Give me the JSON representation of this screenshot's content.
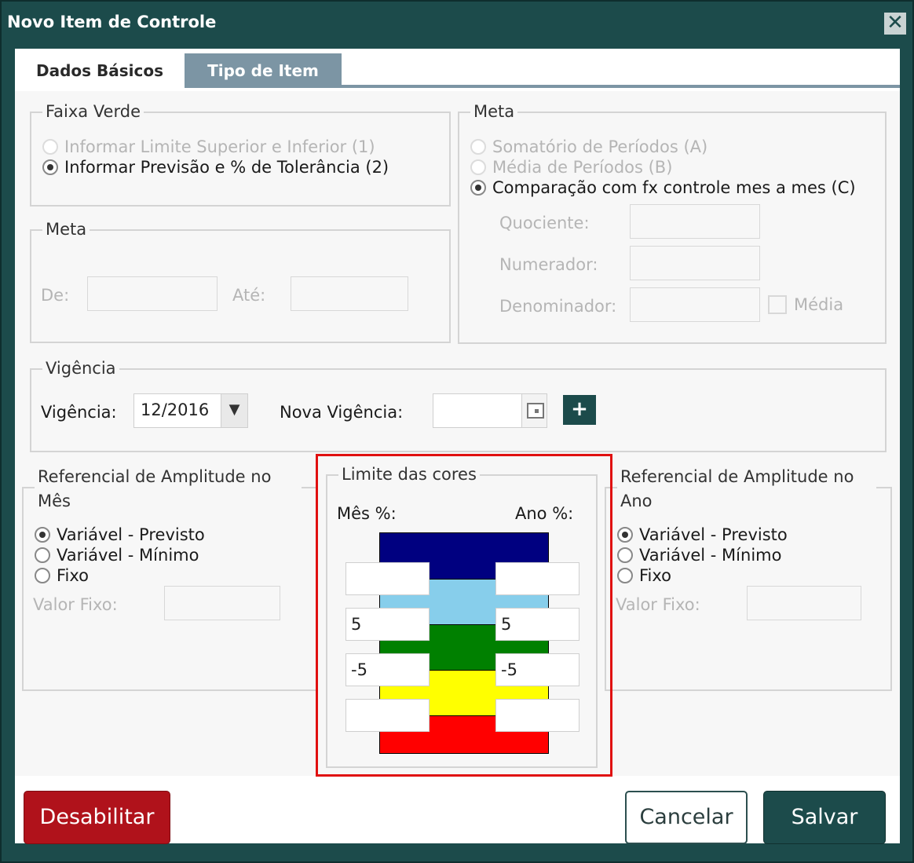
{
  "dialog": {
    "title": "Novo Item de Controle",
    "close_symbol": "✕"
  },
  "tabs": [
    "Dados Básicos",
    "Tipo de Item"
  ],
  "faixa_verde": {
    "legend": "Faixa Verde",
    "options": [
      "Informar Limite Superior e Inferior (1)",
      "Informar Previsão e % de Tolerância (2)"
    ]
  },
  "meta_left": {
    "legend": "Meta",
    "de_label": "De:",
    "ate_label": "Até:"
  },
  "meta_right": {
    "legend": "Meta",
    "options": [
      "Somatório de Períodos (A)",
      "Média de Períodos (B)",
      "Comparação com fx controle mes a mes (C)"
    ],
    "quociente_label": "Quociente:",
    "numerador_label": "Numerador:",
    "denominador_label": "Denominador:",
    "media_label": "Média"
  },
  "vigencia": {
    "legend": "Vigência",
    "label": "Vigência:",
    "value": "12/2016",
    "nova_label": "Nova Vigência:",
    "plus": "+"
  },
  "ref_mes": {
    "legend": "Referencial de Amplitude no Mês",
    "options": [
      "Variável - Previsto",
      "Variável - Mínimo",
      "Fixo"
    ],
    "valor_fixo_label": "Valor Fixo:"
  },
  "limite_cores": {
    "legend": "Limite das cores",
    "mes_label": "Mês %:",
    "ano_label": "Ano %:",
    "bands": [
      "#000080",
      "#87ceeb",
      "#008000",
      "#ffff00",
      "#ff0000"
    ],
    "mes_values": [
      "",
      "5",
      "-5",
      ""
    ],
    "ano_values": [
      "",
      "5",
      "-5",
      ""
    ]
  },
  "ref_ano": {
    "legend": "Referencial de Amplitude no Ano",
    "options": [
      "Variável - Previsto",
      "Variável - Mínimo",
      "Fixo"
    ],
    "valor_fixo_label": "Valor Fixo:"
  },
  "footer": {
    "disable": "Desabilitar",
    "cancel": "Cancelar",
    "save": "Salvar"
  }
}
